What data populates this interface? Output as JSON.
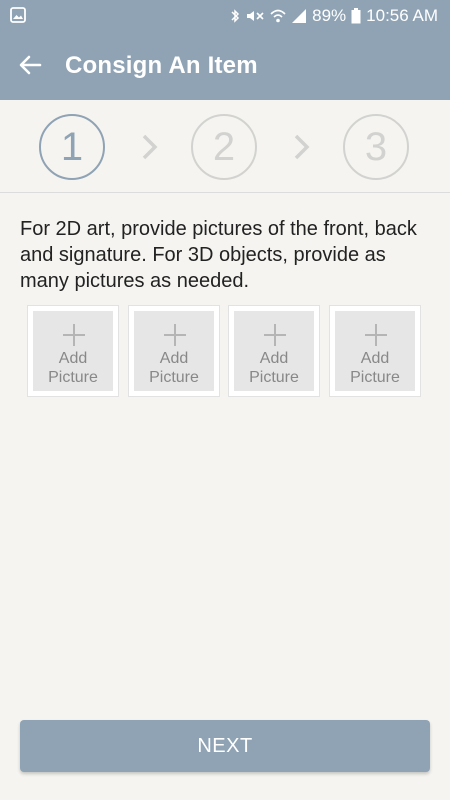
{
  "status_bar": {
    "battery": "89%",
    "time": "10:56 AM",
    "icons": [
      "gallery-icon",
      "bluetooth-icon",
      "mute-icon",
      "wifi-icon",
      "signal-icon",
      "battery-icon"
    ]
  },
  "header": {
    "title": "Consign An Item",
    "back_icon": "arrow-back-icon"
  },
  "stepper": {
    "steps": [
      "1",
      "2",
      "3"
    ],
    "active_step": "1"
  },
  "instructions": "For 2D art, provide pictures of the front, back and signature. For 3D objects, provide as many pictures as needed.",
  "picture_slots": [
    {
      "line1": "Add",
      "line2": "Picture"
    },
    {
      "line1": "Add",
      "line2": "Picture"
    },
    {
      "line1": "Add",
      "line2": "Picture"
    },
    {
      "line1": "Add",
      "line2": "Picture"
    }
  ],
  "next_button": "NEXT",
  "colors": {
    "primary": "#8fa3b5",
    "background": "#f5f4f0",
    "inactive": "#d2d2d0"
  }
}
